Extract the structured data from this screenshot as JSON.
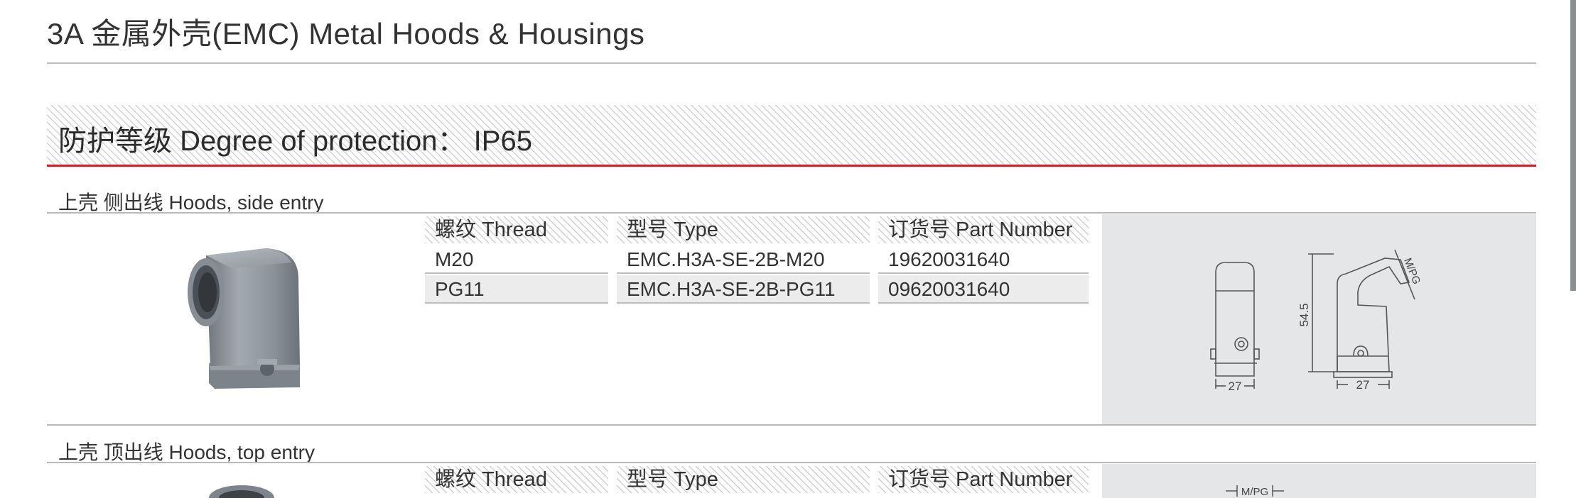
{
  "page": {
    "title": "3A 金属外壳(EMC) Metal Hoods & Housings",
    "protection": "防护等级 Degree of protection： IP65"
  },
  "sections": [
    {
      "title": "上壳 侧出线 Hoods, side entry",
      "headers": [
        "螺纹 Thread",
        "型号 Type",
        "订货号 Part Number"
      ],
      "rows": [
        [
          "M20",
          "EMC.H3A-SE-2B-M20",
          "19620031640"
        ],
        [
          "PG11",
          "EMC.H3A-SE-2B-PG11",
          "09620031640"
        ]
      ],
      "drawing": {
        "height_label": "54.5",
        "width_label_front": "27",
        "width_label_side": "27",
        "entry_label": "M/PG"
      }
    },
    {
      "title": "上壳 顶出线 Hoods, top entry",
      "headers": [
        "螺纹 Thread",
        "型号 Type",
        "订货号 Part Number"
      ],
      "rows": [],
      "drawing": {
        "entry_label": "M/PG"
      }
    }
  ],
  "colors": {
    "accent_red": "#c7232f",
    "panel_gray": "#e5e6e7",
    "row_alt": "#ececec",
    "hood_gray": "#8e949b"
  },
  "icons": [
    "side-entry-hood-photo",
    "top-entry-hood-photo"
  ]
}
